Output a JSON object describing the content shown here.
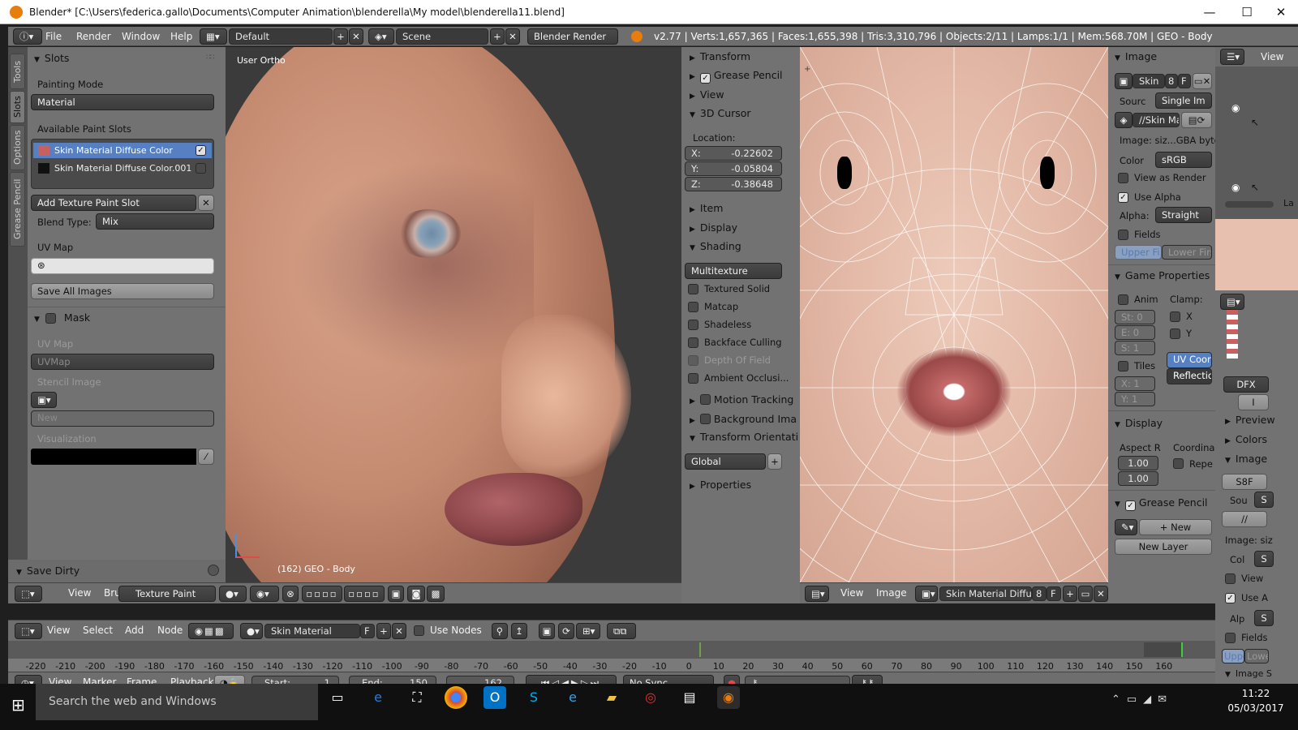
{
  "window": {
    "title": "Blender* [C:\\Users\\federica.gallo\\Documents\\Computer Animation\\blenderella\\My model\\blenderella11.blend]",
    "min": "—",
    "max": "☐",
    "close": "✕"
  },
  "menu": {
    "file": "File",
    "render": "Render",
    "window": "Window",
    "help": "Help",
    "layout": "Default",
    "scene": "Scene",
    "engine": "Blender Render",
    "stats": "v2.77 | Verts:1,657,365 | Faces:1,655,398 | Tris:3,310,796 | Objects:2/11 | Lamps:1/1 | Mem:568.70M | GEO - Body"
  },
  "left_tabs": [
    "Tools",
    "Slots",
    "Options",
    "Grease Pencil"
  ],
  "slots": {
    "header": "Slots",
    "painting_mode_label": "Painting Mode",
    "painting_mode": "Material",
    "available_label": "Available Paint Slots",
    "items": [
      "Skin Material Diffuse Color",
      "Skin Material Diffuse Color.001"
    ],
    "add_slot": "Add Texture Paint Slot",
    "blend_label": "Blend Type:",
    "blend": "Mix",
    "uvmap_label": "UV Map",
    "save_all": "Save All Images"
  },
  "mask": {
    "header": "Mask",
    "uvmap_label": "UV Map",
    "uvmap": "UVMap",
    "stencil_label": "Stencil Image",
    "new": "New",
    "visualization": "Visualization"
  },
  "save_dirty": "Save Dirty",
  "viewport": {
    "label": "User Ortho",
    "object": "(162) GEO - Body"
  },
  "viewport_header": {
    "view": "View",
    "brush": "Brush",
    "mode": "Texture Paint"
  },
  "npanel": {
    "transform": "Transform",
    "grease": "Grease Pencil",
    "view": "View",
    "cursor": "3D Cursor",
    "location": "Location:",
    "x_label": "X:",
    "x": "-0.22602",
    "y_label": "Y:",
    "y": "-0.05804",
    "z_label": "Z:",
    "z": "-0.38648",
    "item": "Item",
    "display": "Display",
    "shading": "Shading",
    "shading_mode": "Multitexture",
    "shade_opts": [
      "Textured Solid",
      "Matcap",
      "Shadeless",
      "Backface Culling",
      "Depth Of Field",
      "Ambient Occlusi..."
    ],
    "motion": "Motion Tracking",
    "background": "Background Ima",
    "orientation": "Transform Orientati",
    "global": "Global",
    "properties": "Properties"
  },
  "uv_header": {
    "view": "View",
    "image": "Image",
    "name": "Skin Material Diffus...",
    "num": "8",
    "f": "F",
    "view2": "View"
  },
  "image_panel": {
    "header": "Image",
    "name": "Skin",
    "num": "8",
    "f": "F",
    "source_label": "Sourc",
    "source": "Single Im",
    "path": "//Skin Ma",
    "info": "Image: siz...GBA byte",
    "color_label": "Color",
    "color": "sRGB",
    "view_as_render": "View as Render",
    "use_alpha": "Use Alpha",
    "alpha_label": "Alpha:",
    "alpha": "Straight",
    "fields": "Fields",
    "upper": "Upper Fi...",
    "lower": "Lower First"
  },
  "game": {
    "header": "Game Properties",
    "anim": "Anim",
    "clamp": "Clamp:",
    "st": "St: 0",
    "e": "E: 0",
    "s": "S: 1",
    "x": "X",
    "y": "Y",
    "tiles": "Tiles",
    "uvcoor": "UV Coor",
    "reflection": "Reflectio",
    "tx": "X: 1",
    "ty": "Y: 1"
  },
  "display2": {
    "header": "Display",
    "aspect": "Aspect R",
    "coord": "Coordina",
    "a1": "1.00",
    "a2": "1.00",
    "repeat": "Repe"
  },
  "grease2": {
    "header": "Grease Pencil",
    "new": "New",
    "new_layer": "New Layer"
  },
  "outliner": {
    "view": "View",
    "la": "La"
  },
  "props_right": {
    "preview": "Preview",
    "colors": "Colors",
    "image": "Image",
    "sbf": "S8F",
    "sou": "Sou",
    "s": "S",
    "path": "//",
    "imgsiz": "Image: siz",
    "col": "Col",
    "view": "View",
    "use_a": "Use A",
    "alp": "Alp",
    "fields": "Fields",
    "upper": "Uppe",
    "lower": "Lowe",
    "imageS": "Image S",
    "dfx": "DFX",
    "i": "I"
  },
  "node_header": {
    "view": "View",
    "select": "Select",
    "add": "Add",
    "node": "Node",
    "material": "Skin Material",
    "f": "F",
    "use_nodes": "Use Nodes"
  },
  "timeline": {
    "ticks": [
      "-220",
      "-210",
      "-200",
      "-190",
      "-180",
      "-170",
      "-160",
      "-150",
      "-140",
      "-130",
      "-120",
      "-110",
      "-100",
      "-90",
      "-80",
      "-70",
      "-60",
      "-50",
      "-40",
      "-30",
      "-20",
      "-10",
      "0",
      "10",
      "20",
      "30",
      "40",
      "50",
      "60",
      "70",
      "80",
      "90",
      "100",
      "110",
      "120",
      "130",
      "140",
      "150",
      "160"
    ],
    "view": "View",
    "marker": "Marker",
    "frame": "Frame",
    "playback": "Playback",
    "start_label": "Start:",
    "start": "1",
    "end_label": "End:",
    "end": "150",
    "current": "162",
    "sync": "No Sync"
  },
  "taskbar": {
    "search": "Search the web and Windows",
    "time": "11:22",
    "date": "05/03/2017"
  }
}
